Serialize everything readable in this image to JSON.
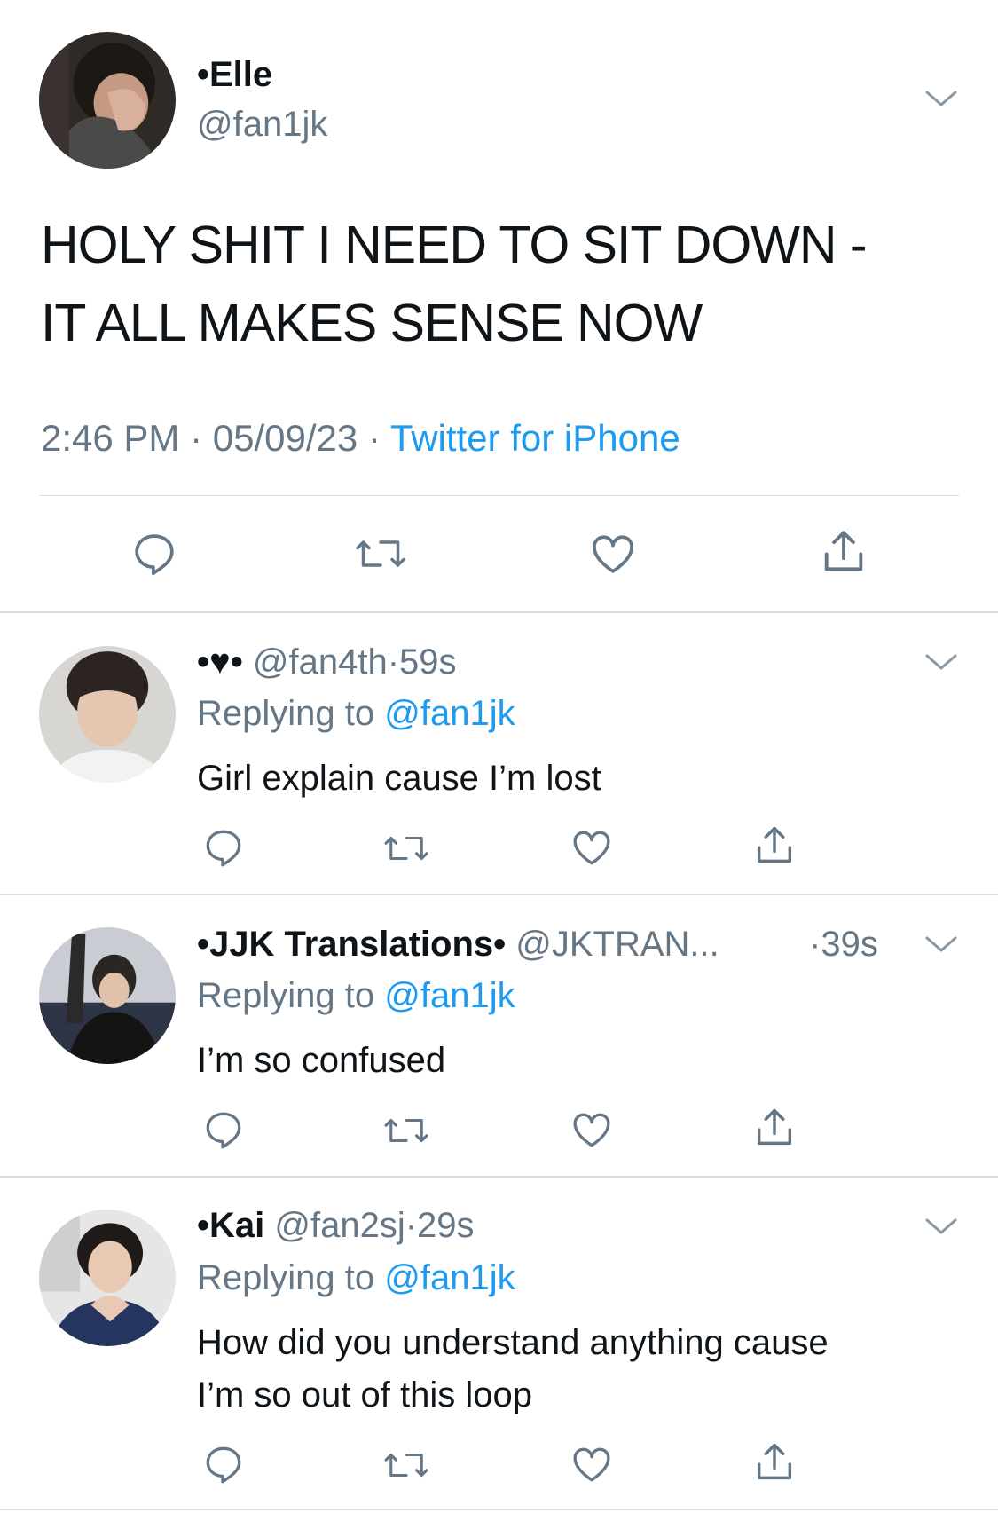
{
  "main_tweet": {
    "display_name": "•Elle",
    "handle": "@fan1jk",
    "text_lines": [
      "HOLY SHIT I NEED TO SIT DOWN -",
      "IT ALL MAKES SENSE NOW"
    ],
    "time": "2:46 PM",
    "separator": "·",
    "date": "05/09/23",
    "source": "Twitter for iPhone"
  },
  "replies": [
    {
      "display_name": "•♥•",
      "handle": "@fan4th",
      "separator": "·",
      "time": "59s",
      "replying_prefix": "Replying to",
      "replying_to": "@fan1jk",
      "text_lines": [
        "Girl explain cause I’m lost"
      ]
    },
    {
      "display_name": "•JJK Translations•",
      "handle": "@JKTRAN...",
      "separator": "·",
      "time": "39s",
      "replying_prefix": "Replying to",
      "replying_to": "@fan1jk",
      "text_lines": [
        "I’m so confused"
      ]
    },
    {
      "display_name": "•Kai",
      "handle": "@fan2sj",
      "separator": "·",
      "time": "29s",
      "replying_prefix": "Replying to",
      "replying_to": "@fan1jk",
      "text_lines": [
        "How did you understand anything cause",
        "I’m so out of this loop"
      ]
    }
  ],
  "icons": {
    "reply": "reply-icon",
    "retweet": "retweet-icon",
    "like": "like-icon",
    "share": "share-icon",
    "more": "chevron-down-icon"
  },
  "colors": {
    "text": "#0f1419",
    "secondary": "#657786",
    "link": "#1d9bf0",
    "divider": "#d7dde2"
  }
}
